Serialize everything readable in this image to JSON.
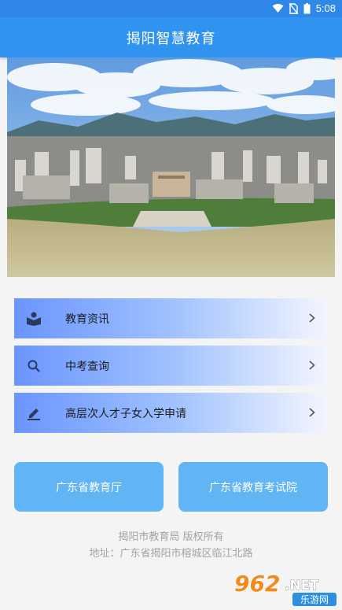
{
  "status_bar": {
    "time": "5:08",
    "icons": [
      "wifi-icon",
      "no-sim-icon",
      "battery-icon"
    ]
  },
  "app_bar": {
    "title": "揭阳智慧教育"
  },
  "menu_items": [
    {
      "label": "教育资讯",
      "icon": "book-reader-icon"
    },
    {
      "label": "中考查询",
      "icon": "search-icon"
    },
    {
      "label": "高层次人才子女入学申请",
      "icon": "pencil-edit-icon"
    }
  ],
  "buttons": {
    "left": "广东省教育厅",
    "right": "广东省教育考试院"
  },
  "footer": {
    "copyright": "揭阳市教育局 版权所有",
    "address": "地址：广东省揭阳市榕城区临江北路"
  },
  "watermark": {
    "text_main": "962",
    "text_net": ".NET",
    "text_sub": "乐游网"
  },
  "colors": {
    "primary": "#3193f0",
    "button": "#62b5f5",
    "menu_gradient_start": "#6b95ff",
    "menu_gradient_end": "#f4f6ff",
    "footer_text": "#a3a3a3"
  }
}
